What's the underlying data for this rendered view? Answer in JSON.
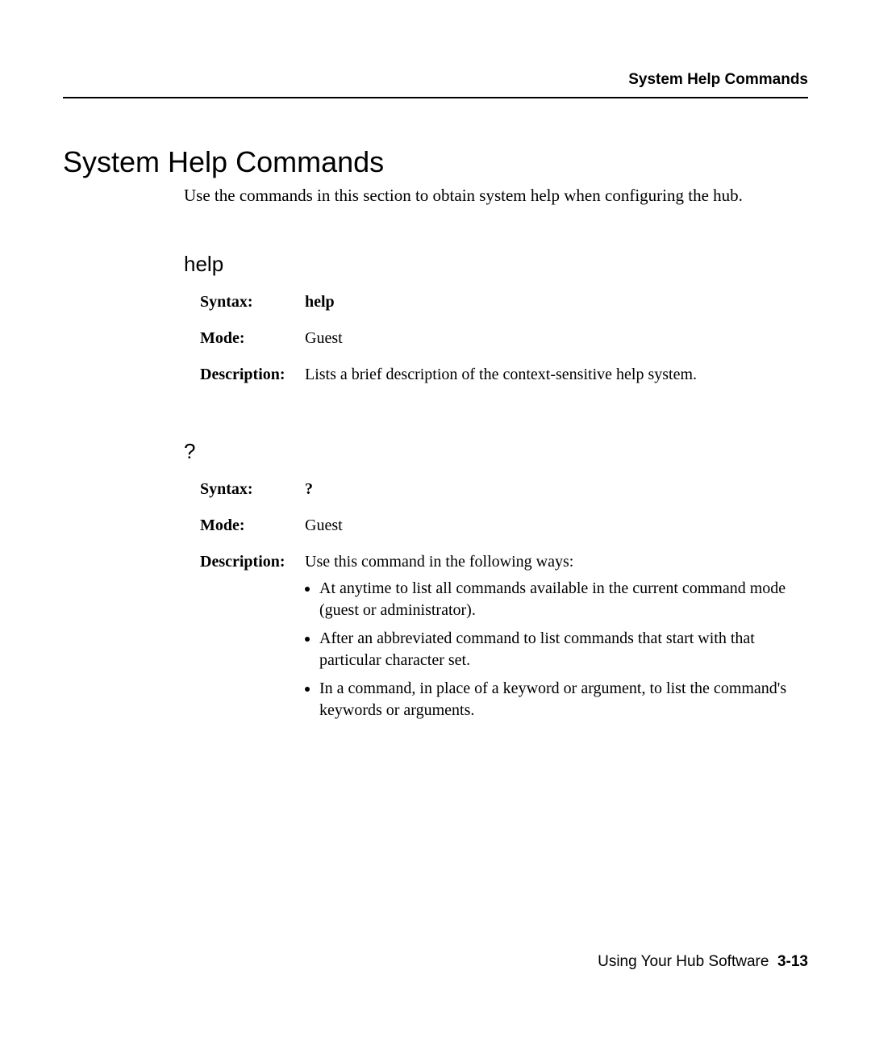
{
  "running_head": "System Help Commands",
  "title": "System Help Commands",
  "intro": "Use the commands in this section to obtain system help when configuring the hub.",
  "labels": {
    "syntax": "Syntax:",
    "mode": "Mode:",
    "description": "Description:"
  },
  "cmd1": {
    "name": "help",
    "syntax": "help",
    "mode": "Guest",
    "desc": "Lists a brief description of the context-sensitive help system."
  },
  "cmd2": {
    "name": "?",
    "syntax": "?",
    "mode": "Guest",
    "desc_intro": "Use this command in the following ways:",
    "bullets": [
      "At anytime to list all commands available in the current command mode (guest or administrator).",
      "After an abbreviated command to list commands that start with that particular character set.",
      "In a command, in place of a keyword or argument, to list the command's keywords or arguments."
    ]
  },
  "footer": {
    "text": "Using Your Hub Software",
    "page": "3-13"
  }
}
